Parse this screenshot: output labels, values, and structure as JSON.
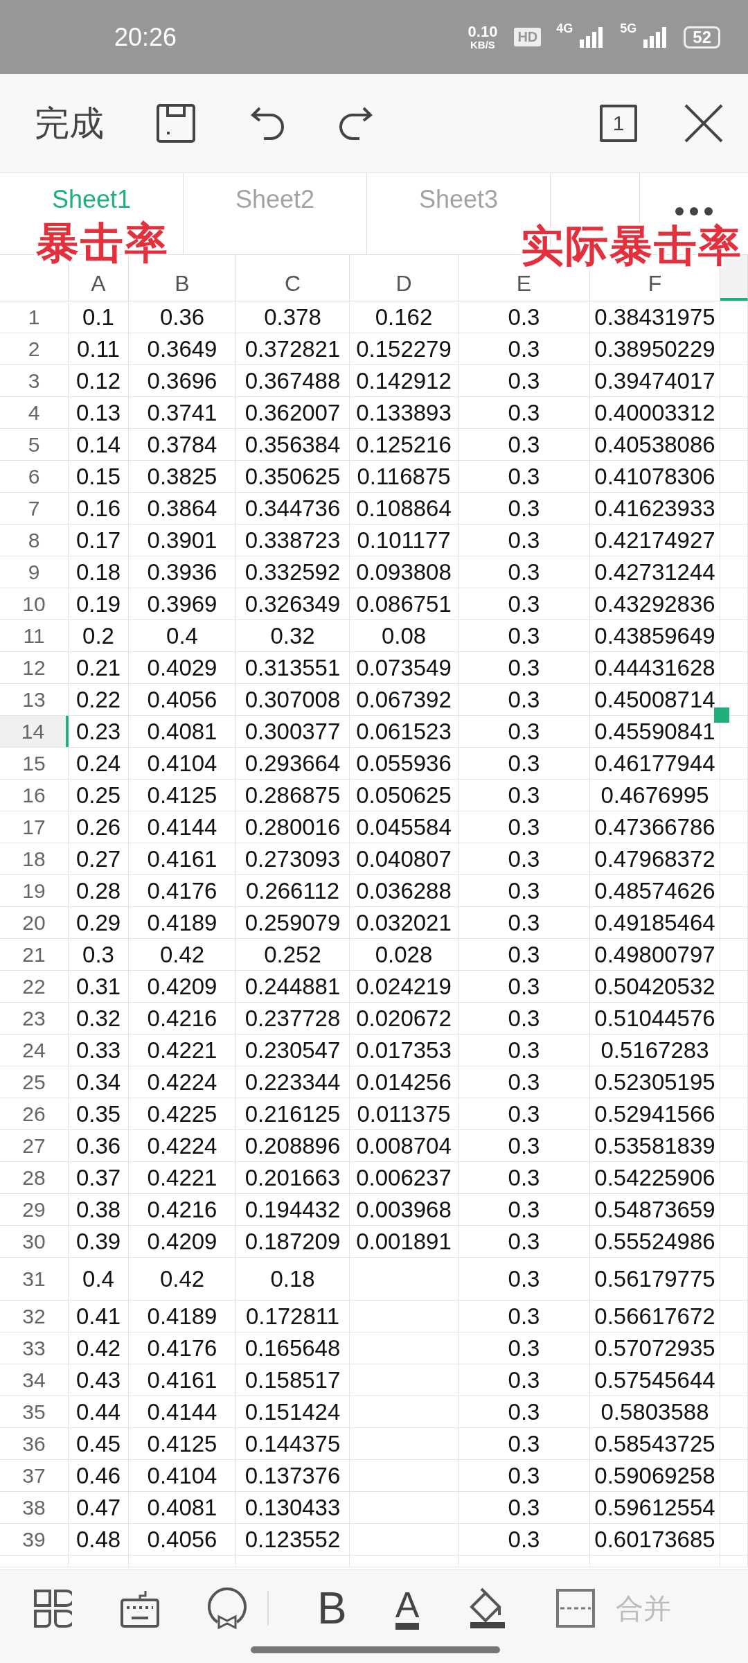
{
  "status_bar": {
    "time": "20:26",
    "speed": "0.10",
    "speed_unit": "KB/S",
    "hd": "HD",
    "network_1": "4G",
    "network_2": "5G",
    "battery": "52"
  },
  "toolbar": {
    "done": "完成",
    "sheet_count": "1"
  },
  "tabs": [
    {
      "label": "Sheet1",
      "selected": true
    },
    {
      "label": "Sheet2",
      "selected": false
    },
    {
      "label": "Sheet3",
      "selected": false
    }
  ],
  "annotations": [
    {
      "text": "暴击率"
    },
    {
      "text": "实际暴击率"
    }
  ],
  "columns": [
    "A",
    "B",
    "C",
    "D",
    "E",
    "F"
  ],
  "rows": [
    {
      "num": "1",
      "cells": [
        "0.1",
        "0.36",
        "0.378",
        "0.162",
        "0.3",
        "0.38431975"
      ],
      "selected": false
    },
    {
      "num": "2",
      "cells": [
        "0.11",
        "0.3649",
        "0.372821",
        "0.152279",
        "0.3",
        "0.38950229"
      ],
      "selected": false
    },
    {
      "num": "3",
      "cells": [
        "0.12",
        "0.3696",
        "0.367488",
        "0.142912",
        "0.3",
        "0.39474017"
      ],
      "selected": false
    },
    {
      "num": "4",
      "cells": [
        "0.13",
        "0.3741",
        "0.362007",
        "0.133893",
        "0.3",
        "0.40003312"
      ],
      "selected": false
    },
    {
      "num": "5",
      "cells": [
        "0.14",
        "0.3784",
        "0.356384",
        "0.125216",
        "0.3",
        "0.40538086"
      ],
      "selected": false
    },
    {
      "num": "6",
      "cells": [
        "0.15",
        "0.3825",
        "0.350625",
        "0.116875",
        "0.3",
        "0.41078306"
      ],
      "selected": false
    },
    {
      "num": "7",
      "cells": [
        "0.16",
        "0.3864",
        "0.344736",
        "0.108864",
        "0.3",
        "0.41623933"
      ],
      "selected": false
    },
    {
      "num": "8",
      "cells": [
        "0.17",
        "0.3901",
        "0.338723",
        "0.101177",
        "0.3",
        "0.42174927"
      ],
      "selected": false
    },
    {
      "num": "9",
      "cells": [
        "0.18",
        "0.3936",
        "0.332592",
        "0.093808",
        "0.3",
        "0.42731244"
      ],
      "selected": false
    },
    {
      "num": "10",
      "cells": [
        "0.19",
        "0.3969",
        "0.326349",
        "0.086751",
        "0.3",
        "0.43292836"
      ],
      "selected": false
    },
    {
      "num": "11",
      "cells": [
        "0.2",
        "0.4",
        "0.32",
        "0.08",
        "0.3",
        "0.43859649"
      ],
      "selected": false
    },
    {
      "num": "12",
      "cells": [
        "0.21",
        "0.4029",
        "0.313551",
        "0.073549",
        "0.3",
        "0.44431628"
      ],
      "selected": false
    },
    {
      "num": "13",
      "cells": [
        "0.22",
        "0.4056",
        "0.307008",
        "0.067392",
        "0.3",
        "0.45008714"
      ],
      "selected": false
    },
    {
      "num": "14",
      "cells": [
        "0.23",
        "0.4081",
        "0.300377",
        "0.061523",
        "0.3",
        "0.45590841"
      ],
      "selected": true
    },
    {
      "num": "15",
      "cells": [
        "0.24",
        "0.4104",
        "0.293664",
        "0.055936",
        "0.3",
        "0.46177944"
      ],
      "selected": false
    },
    {
      "num": "16",
      "cells": [
        "0.25",
        "0.4125",
        "0.286875",
        "0.050625",
        "0.3",
        "0.4676995"
      ],
      "selected": false
    },
    {
      "num": "17",
      "cells": [
        "0.26",
        "0.4144",
        "0.280016",
        "0.045584",
        "0.3",
        "0.47366786"
      ],
      "selected": false
    },
    {
      "num": "18",
      "cells": [
        "0.27",
        "0.4161",
        "0.273093",
        "0.040807",
        "0.3",
        "0.47968372"
      ],
      "selected": false
    },
    {
      "num": "19",
      "cells": [
        "0.28",
        "0.4176",
        "0.266112",
        "0.036288",
        "0.3",
        "0.48574626"
      ],
      "selected": false
    },
    {
      "num": "20",
      "cells": [
        "0.29",
        "0.4189",
        "0.259079",
        "0.032021",
        "0.3",
        "0.49185464"
      ],
      "selected": false
    },
    {
      "num": "21",
      "cells": [
        "0.3",
        "0.42",
        "0.252",
        "0.028",
        "0.3",
        "0.49800797"
      ],
      "selected": false
    },
    {
      "num": "22",
      "cells": [
        "0.31",
        "0.4209",
        "0.244881",
        "0.024219",
        "0.3",
        "0.50420532"
      ],
      "selected": false
    },
    {
      "num": "23",
      "cells": [
        "0.32",
        "0.4216",
        "0.237728",
        "0.020672",
        "0.3",
        "0.51044576"
      ],
      "selected": false
    },
    {
      "num": "24",
      "cells": [
        "0.33",
        "0.4221",
        "0.230547",
        "0.017353",
        "0.3",
        "0.5167283"
      ],
      "selected": false
    },
    {
      "num": "25",
      "cells": [
        "0.34",
        "0.4224",
        "0.223344",
        "0.014256",
        "0.3",
        "0.52305195"
      ],
      "selected": false
    },
    {
      "num": "26",
      "cells": [
        "0.35",
        "0.4225",
        "0.216125",
        "0.011375",
        "0.3",
        "0.52941566"
      ],
      "selected": false
    },
    {
      "num": "27",
      "cells": [
        "0.36",
        "0.4224",
        "0.208896",
        "0.008704",
        "0.3",
        "0.53581839"
      ],
      "selected": false
    },
    {
      "num": "28",
      "cells": [
        "0.37",
        "0.4221",
        "0.201663",
        "0.006237",
        "0.3",
        "0.54225906"
      ],
      "selected": false
    },
    {
      "num": "29",
      "cells": [
        "0.38",
        "0.4216",
        "0.194432",
        "0.003968",
        "0.3",
        "0.54873659"
      ],
      "selected": false
    },
    {
      "num": "30",
      "cells": [
        "0.39",
        "0.4209",
        "0.187209",
        "0.001891",
        "0.3",
        "0.55524986"
      ],
      "selected": false
    },
    {
      "num": "31",
      "cells": [
        "0.4",
        "0.42",
        "0.18",
        null,
        "0.3",
        "0.56179775"
      ],
      "selected": false
    },
    {
      "num": "32",
      "cells": [
        "0.41",
        "0.4189",
        "0.172811",
        null,
        "0.3",
        "0.56617672"
      ],
      "selected": false
    },
    {
      "num": "33",
      "cells": [
        "0.42",
        "0.4176",
        "0.165648",
        null,
        "0.3",
        "0.57072935"
      ],
      "selected": false
    },
    {
      "num": "34",
      "cells": [
        "0.43",
        "0.4161",
        "0.158517",
        null,
        "0.3",
        "0.57545644"
      ],
      "selected": false
    },
    {
      "num": "35",
      "cells": [
        "0.44",
        "0.4144",
        "0.151424",
        null,
        "0.3",
        "0.5803588"
      ],
      "selected": false
    },
    {
      "num": "36",
      "cells": [
        "0.45",
        "0.4125",
        "0.144375",
        null,
        "0.3",
        "0.58543725"
      ],
      "selected": false
    },
    {
      "num": "37",
      "cells": [
        "0.46",
        "0.4104",
        "0.137376",
        null,
        "0.3",
        "0.59069258"
      ],
      "selected": false
    },
    {
      "num": "38",
      "cells": [
        "0.47",
        "0.4081",
        "0.130433",
        null,
        "0.3",
        "0.59612554"
      ],
      "selected": false
    },
    {
      "num": "39",
      "cells": [
        "0.48",
        "0.4056",
        "0.123552",
        null,
        "0.3",
        "0.60173685"
      ],
      "selected": false
    }
  ],
  "bottom_bar": {
    "bold": "B",
    "font_color": "A",
    "merge": "合并"
  }
}
